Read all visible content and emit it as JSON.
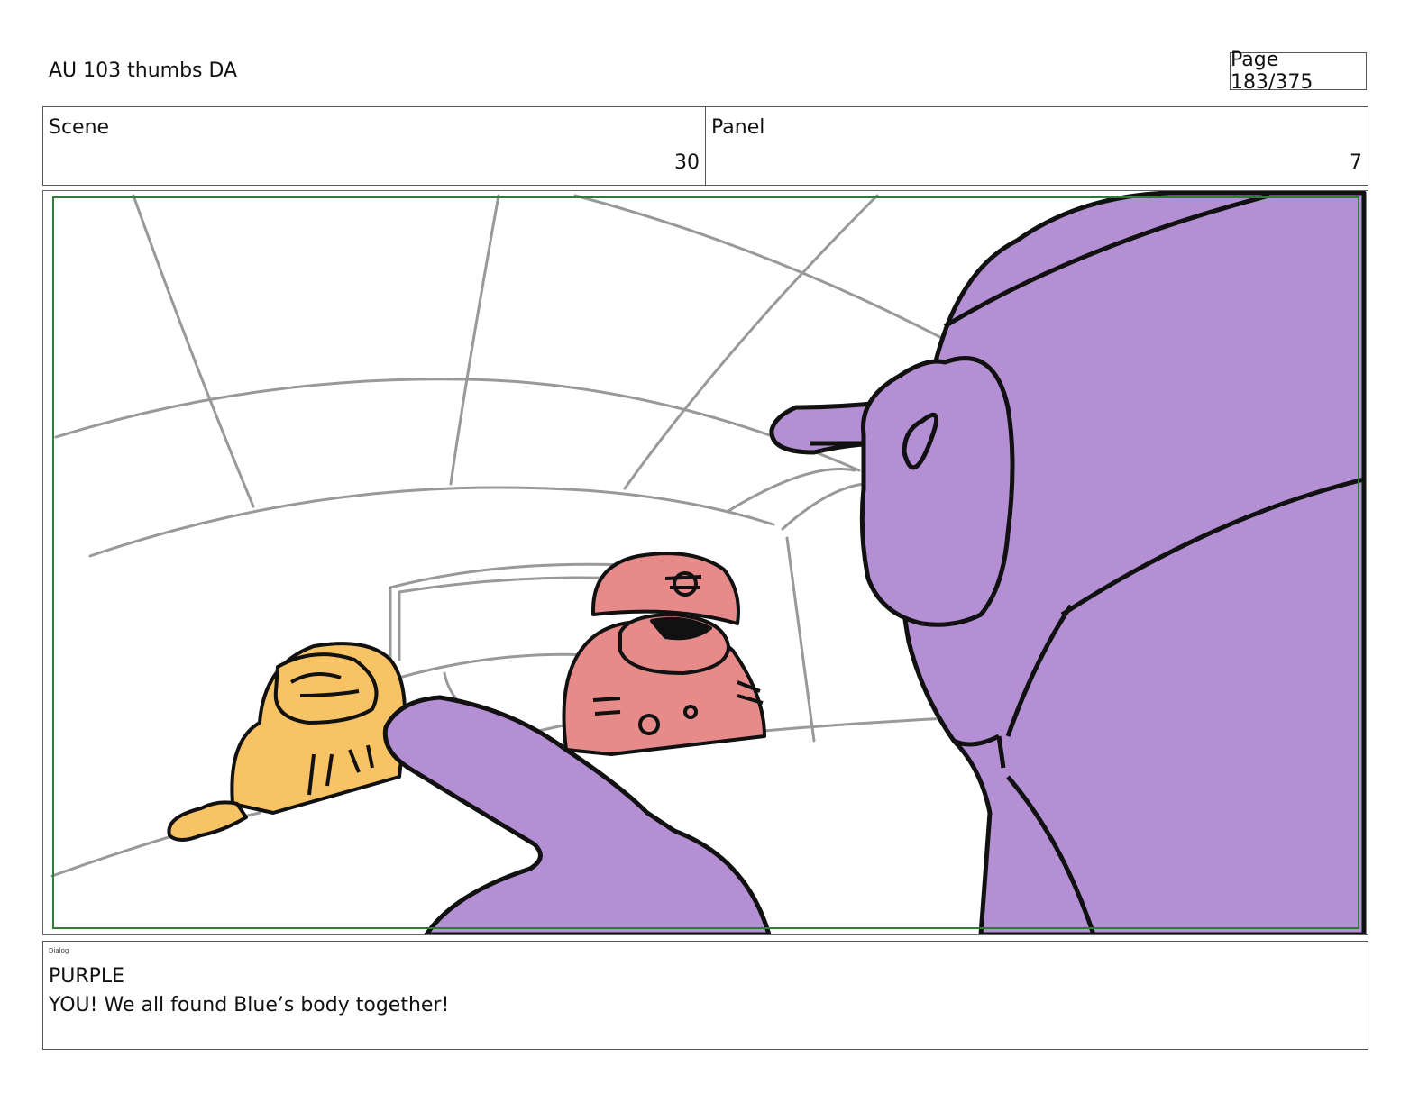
{
  "header": {
    "title": "AU 103 thumbs DA",
    "page": "Page 183/375"
  },
  "info": {
    "scene_label": "Scene",
    "scene_value": "30",
    "panel_label": "Panel",
    "panel_value": "7"
  },
  "frame": {
    "safe_area_color": "#2e7d32",
    "purple_color": "#b48fd4",
    "yellow_color": "#f8c365",
    "pink_color": "#e68a8a",
    "line_color": "#111111",
    "bg_sketch_color": "#999999"
  },
  "dialog": {
    "header": "Dialog",
    "speaker": "PURPLE",
    "line": "YOU! We all found Blue’s body together!"
  }
}
